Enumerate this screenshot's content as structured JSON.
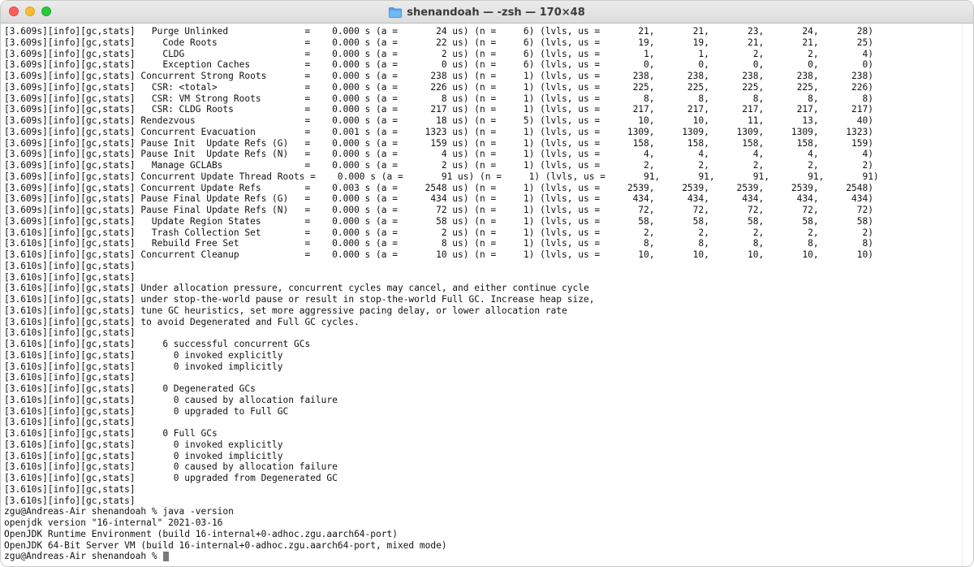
{
  "window": {
    "title": "shenandoah — -zsh — 170×48"
  },
  "icons": {
    "title_icon": "folder-icon"
  },
  "colors": {
    "close": "#ff5f57",
    "minimize": "#febc2e",
    "maximize": "#28c840",
    "folder": "#4aa3f5"
  },
  "terminal": {
    "lines": [
      "[3.609s][info][gc,stats]   Purge Unlinked              =    0.000 s (a =       24 us) (n =     6) (lvls, us =       21,       21,       23,       24,       28)",
      "[3.609s][info][gc,stats]     Code Roots                =    0.000 s (a =       22 us) (n =     6) (lvls, us =       19,       19,       21,       21,       25)",
      "[3.609s][info][gc,stats]     CLDG                      =    0.000 s (a =        2 us) (n =     6) (lvls, us =        1,        1,        2,        2,        4)",
      "[3.609s][info][gc,stats]     Exception Caches          =    0.000 s (a =        0 us) (n =     6) (lvls, us =        0,        0,        0,        0,        0)",
      "[3.609s][info][gc,stats] Concurrent Strong Roots       =    0.000 s (a =      238 us) (n =     1) (lvls, us =      238,      238,      238,      238,      238)",
      "[3.609s][info][gc,stats]   CSR: <total>                =    0.000 s (a =      226 us) (n =     1) (lvls, us =      225,      225,      225,      225,      226)",
      "[3.609s][info][gc,stats]   CSR: VM Strong Roots        =    0.000 s (a =        8 us) (n =     1) (lvls, us =        8,        8,        8,        8,        8)",
      "[3.609s][info][gc,stats]   CSR: CLDG Roots             =    0.000 s (a =      217 us) (n =     1) (lvls, us =      217,      217,      217,      217,      217)",
      "[3.609s][info][gc,stats] Rendezvous                    =    0.000 s (a =       18 us) (n =     5) (lvls, us =       10,       10,       11,       13,       40)",
      "[3.609s][info][gc,stats] Concurrent Evacuation         =    0.001 s (a =     1323 us) (n =     1) (lvls, us =     1309,     1309,     1309,     1309,     1323)",
      "[3.609s][info][gc,stats] Pause Init  Update Refs (G)   =    0.000 s (a =      159 us) (n =     1) (lvls, us =      158,      158,      158,      158,      159)",
      "[3.609s][info][gc,stats] Pause Init  Update Refs (N)   =    0.000 s (a =        4 us) (n =     1) (lvls, us =        4,        4,        4,        4,        4)",
      "[3.609s][info][gc,stats]   Manage GCLABs               =    0.000 s (a =        2 us) (n =     1) (lvls, us =        2,        2,        2,        2,        2)",
      "[3.609s][info][gc,stats] Concurrent Update Thread Roots =    0.000 s (a =       91 us) (n =     1) (lvls, us =       91,       91,       91,       91,       91)",
      "[3.609s][info][gc,stats] Concurrent Update Refs        =    0.003 s (a =     2548 us) (n =     1) (lvls, us =     2539,     2539,     2539,     2539,     2548)",
      "[3.609s][info][gc,stats] Pause Final Update Refs (G)   =    0.000 s (a =      434 us) (n =     1) (lvls, us =      434,      434,      434,      434,      434)",
      "[3.609s][info][gc,stats] Pause Final Update Refs (N)   =    0.000 s (a =       72 us) (n =     1) (lvls, us =       72,       72,       72,       72,       72)",
      "[3.609s][info][gc,stats]   Update Region States        =    0.000 s (a =       58 us) (n =     1) (lvls, us =       58,       58,       58,       58,       58)",
      "[3.610s][info][gc,stats]   Trash Collection Set        =    0.000 s (a =        2 us) (n =     1) (lvls, us =        2,        2,        2,        2,        2)",
      "[3.610s][info][gc,stats]   Rebuild Free Set            =    0.000 s (a =        8 us) (n =     1) (lvls, us =        8,        8,        8,        8,        8)",
      "[3.610s][info][gc,stats] Concurrent Cleanup            =    0.000 s (a =       10 us) (n =     1) (lvls, us =       10,       10,       10,       10,       10)",
      "[3.610s][info][gc,stats]",
      "[3.610s][info][gc,stats]",
      "[3.610s][info][gc,stats] Under allocation pressure, concurrent cycles may cancel, and either continue cycle",
      "[3.610s][info][gc,stats] under stop-the-world pause or result in stop-the-world Full GC. Increase heap size,",
      "[3.610s][info][gc,stats] tune GC heuristics, set more aggressive pacing delay, or lower allocation rate",
      "[3.610s][info][gc,stats] to avoid Degenerated and Full GC cycles.",
      "[3.610s][info][gc,stats]",
      "[3.610s][info][gc,stats]     6 successful concurrent GCs",
      "[3.610s][info][gc,stats]       0 invoked explicitly",
      "[3.610s][info][gc,stats]       0 invoked implicitly",
      "[3.610s][info][gc,stats]",
      "[3.610s][info][gc,stats]     0 Degenerated GCs",
      "[3.610s][info][gc,stats]       0 caused by allocation failure",
      "[3.610s][info][gc,stats]       0 upgraded to Full GC",
      "[3.610s][info][gc,stats]",
      "[3.610s][info][gc,stats]     0 Full GCs",
      "[3.610s][info][gc,stats]       0 invoked explicitly",
      "[3.610s][info][gc,stats]       0 invoked implicitly",
      "[3.610s][info][gc,stats]       0 caused by allocation failure",
      "[3.610s][info][gc,stats]       0 upgraded from Degenerated GC",
      "[3.610s][info][gc,stats]",
      "[3.610s][info][gc,stats]",
      "zgu@Andreas-Air shenandoah % java -version",
      "openjdk version \"16-internal\" 2021-03-16",
      "OpenJDK Runtime Environment (build 16-internal+0-adhoc.zgu.aarch64-port)",
      "OpenJDK 64-Bit Server VM (build 16-internal+0-adhoc.zgu.aarch64-port, mixed mode)"
    ],
    "prompt": "zgu@Andreas-Air shenandoah % "
  }
}
